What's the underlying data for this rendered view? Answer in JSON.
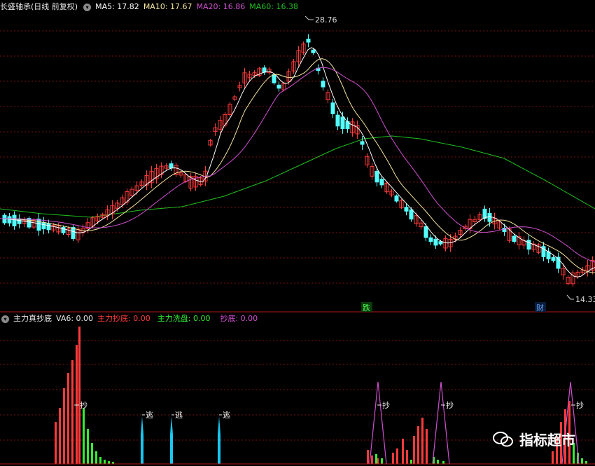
{
  "colors": {
    "up": "#ff3b3b",
    "down": "#54ffff",
    "ma5": "#ffffff",
    "ma10": "#f5e6a0",
    "ma20": "#d050d0",
    "ma60": "#20c020",
    "grid": "#7a1010",
    "vol_green": "#33ee33",
    "escape": "#19c6f0"
  },
  "main_header": {
    "stock": "长盛轴承(日线 前复权)",
    "ma5": "MA5: 17.82",
    "ma10": "MA10: 17.67",
    "ma20": "MA20: 16.86",
    "ma60": "MA60: 16.38"
  },
  "price_labels": {
    "high": "28.76",
    "low": "14.33"
  },
  "events": {
    "e1": "跌",
    "e2": "财"
  },
  "sub_header": {
    "title": "主力真抄底",
    "va6": "VA6: 0.00",
    "zhuli_chaodi": "主力抄底: 0.00",
    "zhuli_xipan": "主力洗盘: 0.00",
    "chaodi": "抄底: 0.00"
  },
  "markers": {
    "chao": "抄",
    "tao": "逃"
  },
  "watermark": "指标超市",
  "icons": {
    "collapse": "chevron-down-icon",
    "logo": "wechat-icon"
  }
}
